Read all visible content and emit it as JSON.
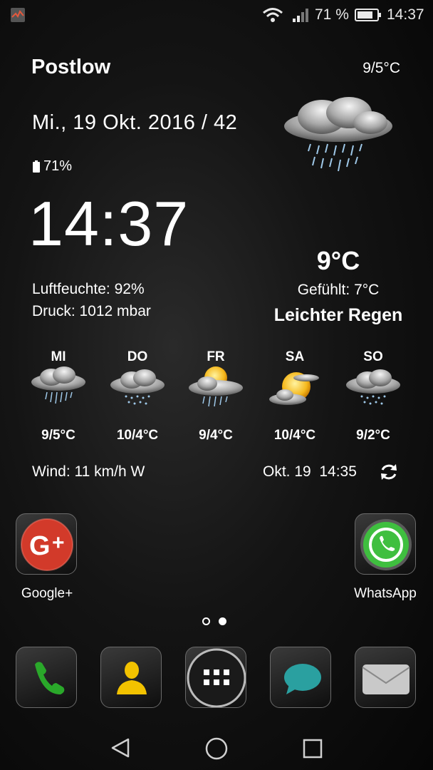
{
  "status_bar": {
    "battery_percent": "71 %",
    "time": "14:37",
    "icons": [
      "app-notification-icon",
      "wifi-icon",
      "signal-icon",
      "battery-icon"
    ]
  },
  "weather": {
    "city": "Postlow",
    "minmax": "9/5°C",
    "date": "Mi., 19 Okt. 2016 / 42",
    "battery": "71%",
    "clock": "14:37",
    "humidity": "Luftfeuchte: 92%",
    "pressure": "Druck: 1012 mbar",
    "current_temp": "9°C",
    "feels_like": "Gefühlt: 7°C",
    "condition": "Leichter Regen",
    "forecast": [
      {
        "day": "MI",
        "temp": "9/5°C",
        "icon": "rain-cloud-icon"
      },
      {
        "day": "DO",
        "temp": "10/4°C",
        "icon": "drizzle-cloud-icon"
      },
      {
        "day": "FR",
        "temp": "9/4°C",
        "icon": "sun-rain-cloud-icon"
      },
      {
        "day": "SA",
        "temp": "10/4°C",
        "icon": "sun-cloud-icon"
      },
      {
        "day": "SO",
        "temp": "9/2°C",
        "icon": "drizzle-cloud-icon"
      }
    ],
    "wind": "Wind: 11 km/h W",
    "updated": "Okt. 19  14:35"
  },
  "apps": {
    "google_plus": "Google+",
    "whatsapp": "WhatsApp"
  },
  "dock": [
    "phone-icon",
    "contacts-icon",
    "app-drawer-icon",
    "messages-icon",
    "email-icon"
  ],
  "colors": {
    "google_red": "#d23a2a",
    "whatsapp_green": "#3fbf3f",
    "phone_green": "#2aa82a",
    "contact_yellow": "#f2c200",
    "msg_teal": "#2aa0a0"
  }
}
